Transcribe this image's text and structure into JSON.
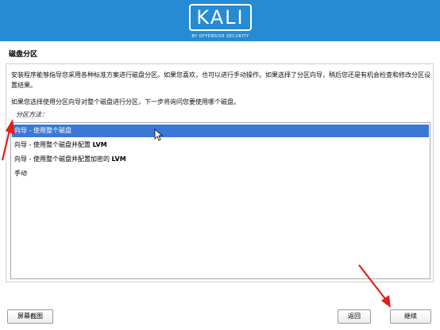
{
  "banner": {
    "logo_text": "KALI",
    "logo_subtitle": "BY OFFENSIVE SECURITY",
    "background_color": "#268bd2"
  },
  "page": {
    "title": "磁盘分区",
    "description": "安装程序能够指导您采用各种标准方案进行磁盘分区。如果您喜欢，也可以进行手动操作。如果选择了分区向导，稍后您还是有机会检查和修改分区设置结果。",
    "question": "如果您选择使用分区向导对整个磁盘进行分区，下一步将询问您要使用哪个磁盘。",
    "list_label": "分区方法："
  },
  "options": [
    {
      "prefix": "向导 - 使用整个磁盘",
      "suffix": "",
      "selected": true
    },
    {
      "prefix": "向导 - 使用整个磁盘并配置 ",
      "suffix": "LVM",
      "selected": false
    },
    {
      "prefix": "向导 - 使用整个磁盘并配置加密的 ",
      "suffix": "LVM",
      "selected": false
    },
    {
      "prefix": "手动",
      "suffix": "",
      "selected": false
    }
  ],
  "buttons": {
    "screenshot": "屏幕截图",
    "back": "返回",
    "continue": "继续"
  },
  "colors": {
    "selection": "#3a78d7",
    "annotation_arrow": "#e0201c"
  },
  "icons": {
    "cursor": "mouse-cursor-icon",
    "annotation": "red-arrow-annotation"
  }
}
